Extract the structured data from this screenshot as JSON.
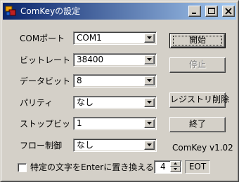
{
  "window": {
    "title": "ComKeyの設定"
  },
  "settings": [
    {
      "label": "COMポート",
      "value": "COM1"
    },
    {
      "label": "ビットレート",
      "value": "38400"
    },
    {
      "label": "データビット",
      "value": "8"
    },
    {
      "label": "パリティ",
      "value": "なし"
    },
    {
      "label": "ストップビット",
      "value": "1"
    },
    {
      "label": "フロー制御",
      "value": "なし"
    }
  ],
  "buttons": {
    "start": "開始",
    "stop": "停止",
    "delete_registry": "レジストリ削除",
    "exit": "終了"
  },
  "version": "ComKey v1.02",
  "replace_option": {
    "label": "特定の文字をEnterに置き換える",
    "checked": false,
    "number": "4",
    "char": "EOT"
  },
  "colors": {
    "face": "#d4d0c8",
    "title_start": "#0a246a",
    "title_end": "#a6caf0"
  }
}
